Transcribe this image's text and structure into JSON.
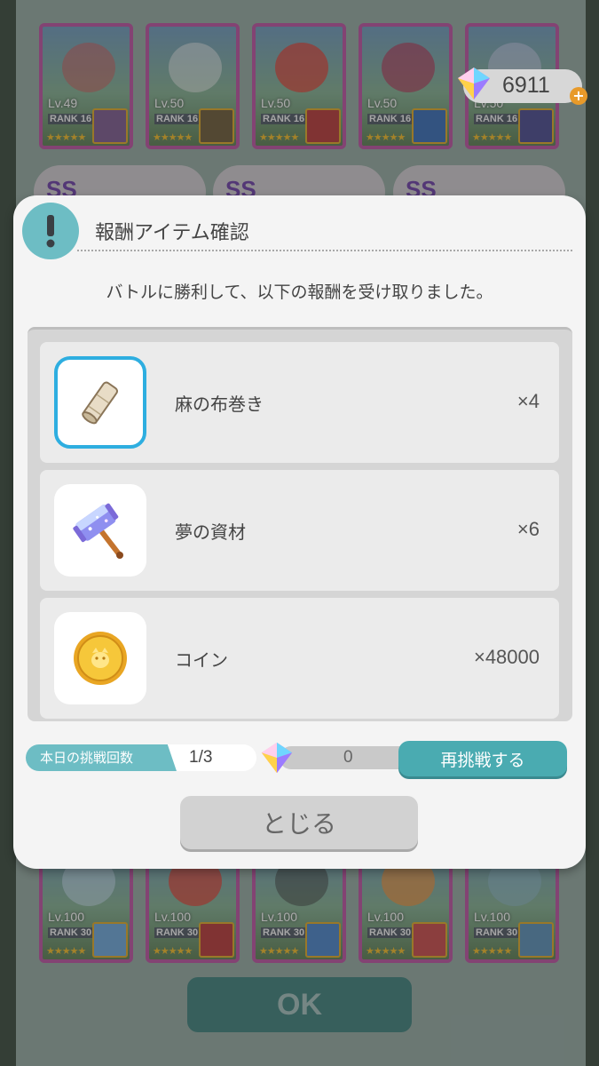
{
  "currency": {
    "gems": "6911",
    "plus_icon": "plus-icon"
  },
  "top_cards": [
    {
      "level": "Lv.49",
      "rank": "RANK 16",
      "stars": "★★★★★"
    },
    {
      "level": "Lv.50",
      "rank": "RANK 16",
      "stars": "★★★★★"
    },
    {
      "level": "Lv.50",
      "rank": "RANK 16",
      "stars": "★★★★★"
    },
    {
      "level": "Lv.50",
      "rank": "RANK 16",
      "stars": "★★★★★"
    },
    {
      "level": "Lv.50",
      "rank": "RANK 16",
      "stars": "★★★★★"
    }
  ],
  "bottom_cards": [
    {
      "level": "Lv.100",
      "rank": "RANK 30",
      "stars": "★★★★★"
    },
    {
      "level": "Lv.100",
      "rank": "RANK 30",
      "stars": "★★★★★"
    },
    {
      "level": "Lv.100",
      "rank": "RANK 30",
      "stars": "★★★★★"
    },
    {
      "level": "Lv.100",
      "rank": "RANK 30",
      "stars": "★★★★★"
    },
    {
      "level": "Lv.100",
      "rank": "RANK 30",
      "stars": "★★★★★"
    }
  ],
  "tier_badges": [
    "SS",
    "SS",
    "SS"
  ],
  "dialog": {
    "title": "報酬アイテム確認",
    "message": "バトルに勝利して、以下の報酬を受け取りました。",
    "rewards": [
      {
        "name": "麻の布巻き",
        "quantity": "×4",
        "icon": "cloth-roll-icon"
      },
      {
        "name": "夢の資材",
        "quantity": "×6",
        "icon": "dream-hammer-icon"
      },
      {
        "name": "コイン",
        "quantity": "×48000",
        "icon": "coin-icon"
      }
    ],
    "attempts_label": "本日の挑戦回数",
    "attempts_value": "1/3",
    "retry_cost": "0",
    "retry_label": "再挑戦する",
    "close_label": "とじる"
  },
  "ok_label": "OK",
  "colors": {
    "accent_teal": "#4aabb1",
    "card_border": "#b4529b",
    "selected_border": "#2eaee0"
  }
}
